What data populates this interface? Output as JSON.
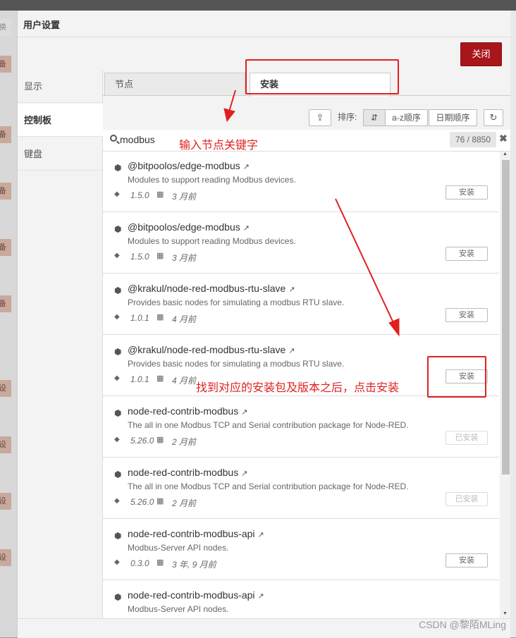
{
  "dialog": {
    "title": "用户设置",
    "close_label": "关闭"
  },
  "sidebar": {
    "items": [
      {
        "label": "显示"
      },
      {
        "label": "控制板"
      },
      {
        "label": "键盘"
      }
    ]
  },
  "tabs": [
    {
      "label": "节点"
    },
    {
      "label": "安装"
    }
  ],
  "sort": {
    "label": "排序:",
    "az_label": "a-z顺序",
    "date_label": "日期顺序"
  },
  "search": {
    "value": "modbus",
    "count": "76 / 8850"
  },
  "packages": [
    {
      "name": "@bitpoolos/edge-modbus",
      "desc": "Modules to support reading Modbus devices.",
      "version": "1.5.0",
      "date": "3 月前",
      "button": "安装"
    },
    {
      "name": "@bitpoolos/edge-modbus",
      "desc": "Modules to support reading Modbus devices.",
      "version": "1.5.0",
      "date": "3 月前",
      "button": "安装"
    },
    {
      "name": "@krakul/node-red-modbus-rtu-slave",
      "desc": "Provides basic nodes for simulating a modbus RTU slave.",
      "version": "1.0.1",
      "date": "4 月前",
      "button": "安装"
    },
    {
      "name": "@krakul/node-red-modbus-rtu-slave",
      "desc": "Provides basic nodes for simulating a modbus RTU slave.",
      "version": "1.0.1",
      "date": "4 月前",
      "button": "安装"
    },
    {
      "name": "node-red-contrib-modbus",
      "desc": "The all in one Modbus TCP and Serial contribution package for Node-RED.",
      "version": "5.26.0",
      "date": "2 月前",
      "button": "已安装"
    },
    {
      "name": "node-red-contrib-modbus",
      "desc": "The all in one Modbus TCP and Serial contribution package for Node-RED.",
      "version": "5.26.0",
      "date": "2 月前",
      "button": "已安装"
    },
    {
      "name": "node-red-contrib-modbus-api",
      "desc": "Modbus-Server API nodes.",
      "version": "0.3.0",
      "date": "3 年, 9 月前",
      "button": "安装"
    },
    {
      "name": "node-red-contrib-modbus-api",
      "desc": "Modbus-Server API nodes.",
      "version": "",
      "date": "",
      "button": ""
    }
  ],
  "annotations": {
    "search_hint": "输入节点关键字",
    "install_hint": "找到对应的安装包及版本之后，点击安装",
    "color": "#e02020"
  },
  "background_tags": [
    "换着",
    "备",
    "备",
    "备",
    "备",
    "备",
    "设计",
    "设计",
    "设计",
    "设计"
  ],
  "watermark": "CSDN @黎陌MLing"
}
